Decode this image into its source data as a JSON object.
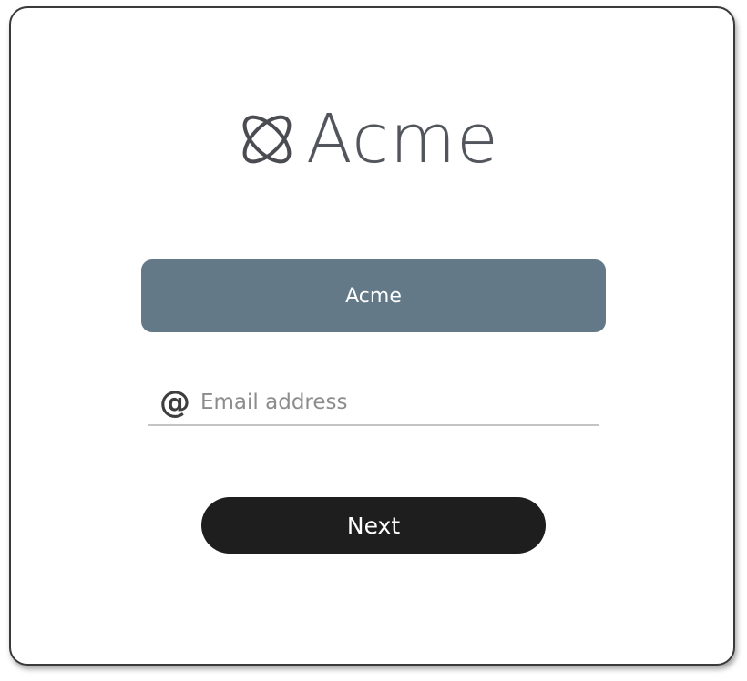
{
  "brand": {
    "name": "Acme",
    "icon": "atom-orbit-icon",
    "color": "#52555c"
  },
  "sso_button": {
    "label": "Acme",
    "color": "#637987"
  },
  "email": {
    "icon": "at-sign-icon",
    "icon_glyph": "@",
    "placeholder": "Email address",
    "value": ""
  },
  "next_button": {
    "label": "Next",
    "color": "#1e1e1e"
  }
}
